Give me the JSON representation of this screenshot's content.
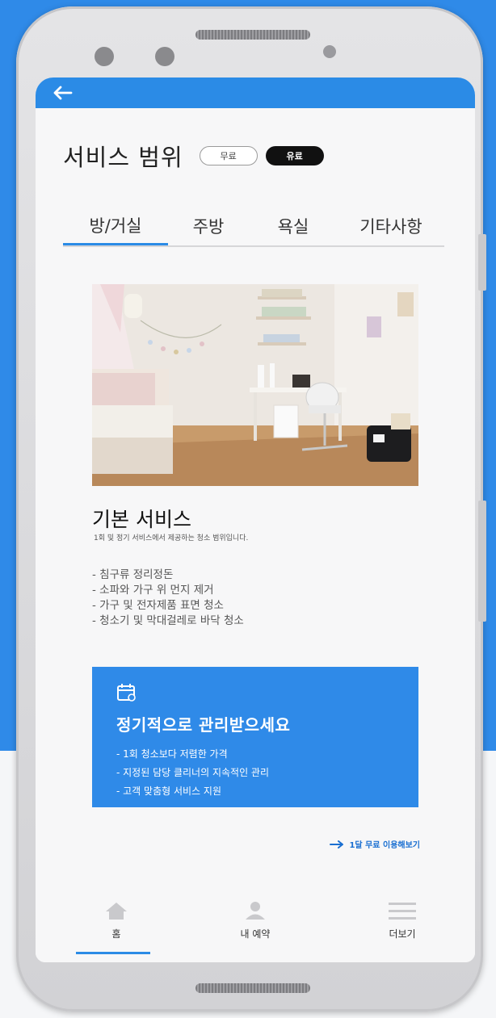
{
  "header": {
    "back_icon": "arrow-left-icon"
  },
  "page": {
    "title": "서비스 범위",
    "badge_free": "무료",
    "badge_paid": "유료"
  },
  "tabs": [
    {
      "label": "방/거실",
      "active": true
    },
    {
      "label": "주방",
      "active": false
    },
    {
      "label": "욕실",
      "active": false
    },
    {
      "label": "기타사항",
      "active": false
    }
  ],
  "basic_service": {
    "title": "기본 서비스",
    "subtitle": "1회 및 정기 서비스에서 제공하는 청소 범위입니다.",
    "items": [
      "- 침구류 정리정돈",
      "- 소파와 가구 위 먼지 제거",
      "- 가구 및 전자제품 표면 청소",
      "- 청소기 및 막대걸레로 바닥 청소"
    ]
  },
  "promo": {
    "icon": "calendar-icon",
    "title": "정기적으로 관리받으세요",
    "items": [
      "- 1회 청소보다 저렴한 가격",
      "- 지정된 담당 클리너의 지속적인 관리",
      "- 고객 맞춤형 서비스 지원"
    ],
    "background": "#2f8ae8"
  },
  "trial_link": "1달 무료 이용해보기",
  "bottom_nav": [
    {
      "label": "홈",
      "icon": "home-icon",
      "active": true
    },
    {
      "label": "내 예약",
      "icon": "person-icon",
      "active": false
    },
    {
      "label": "더보기",
      "icon": "menu-icon",
      "active": false
    }
  ],
  "colors": {
    "accent": "#2b8be6",
    "background_top": "#2f8ae8"
  }
}
